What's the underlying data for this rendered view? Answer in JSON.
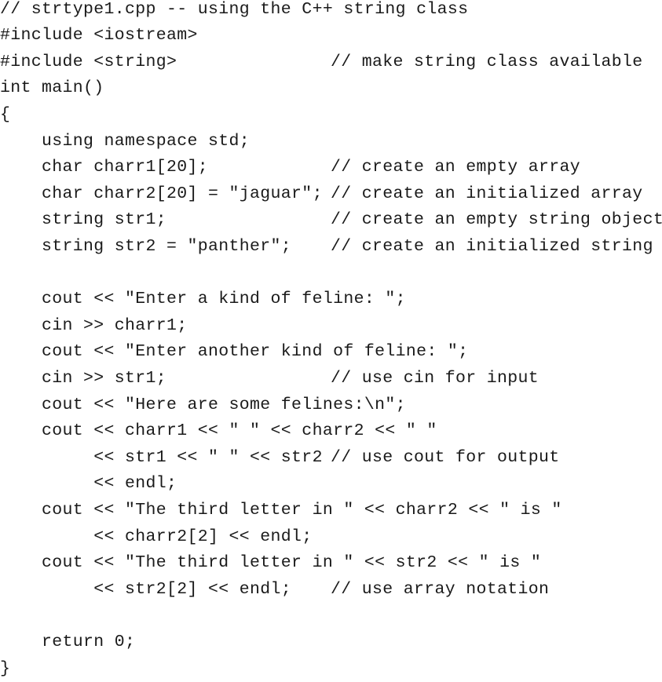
{
  "document": {
    "lines": [
      {
        "code": "// strtype1.cpp -- using the C++ string class",
        "comment": ""
      },
      {
        "code": "#include <iostream>",
        "comment": ""
      },
      {
        "code": "#include <string>",
        "comment": "// make string class available"
      },
      {
        "code": "int main()",
        "comment": ""
      },
      {
        "code": "{",
        "comment": ""
      },
      {
        "code": "    using namespace std;",
        "comment": ""
      },
      {
        "code": "    char charr1[20];",
        "comment": "// create an empty array"
      },
      {
        "code": "    char charr2[20] = \"jaguar\";",
        "comment": "// create an initialized array"
      },
      {
        "code": "    string str1;",
        "comment": "// create an empty string object"
      },
      {
        "code": "    string str2 = \"panther\";",
        "comment": "// create an initialized string"
      },
      {
        "code": "",
        "comment": ""
      },
      {
        "code": "    cout << \"Enter a kind of feline: \";",
        "comment": ""
      },
      {
        "code": "    cin >> charr1;",
        "comment": ""
      },
      {
        "code": "    cout << \"Enter another kind of feline: \";",
        "comment": ""
      },
      {
        "code": "    cin >> str1;",
        "comment": "// use cin for input"
      },
      {
        "code": "    cout << \"Here are some felines:\\n\";",
        "comment": ""
      },
      {
        "code": "    cout << charr1 << \" \" << charr2 << \" \"",
        "comment": ""
      },
      {
        "code": "         << str1 << \" \" << str2",
        "comment": "// use cout for output"
      },
      {
        "code": "         << endl;",
        "comment": ""
      },
      {
        "code": "    cout << \"The third letter in \" << charr2 << \" is \"",
        "comment": ""
      },
      {
        "code": "         << charr2[2] << endl;",
        "comment": ""
      },
      {
        "code": "    cout << \"The third letter in \" << str2 << \" is \"",
        "comment": ""
      },
      {
        "code": "         << str2[2] << endl;",
        "comment": "// use array notation"
      },
      {
        "code": "",
        "comment": ""
      },
      {
        "code": "    return 0;",
        "comment": ""
      },
      {
        "code": "}",
        "comment": ""
      }
    ]
  }
}
